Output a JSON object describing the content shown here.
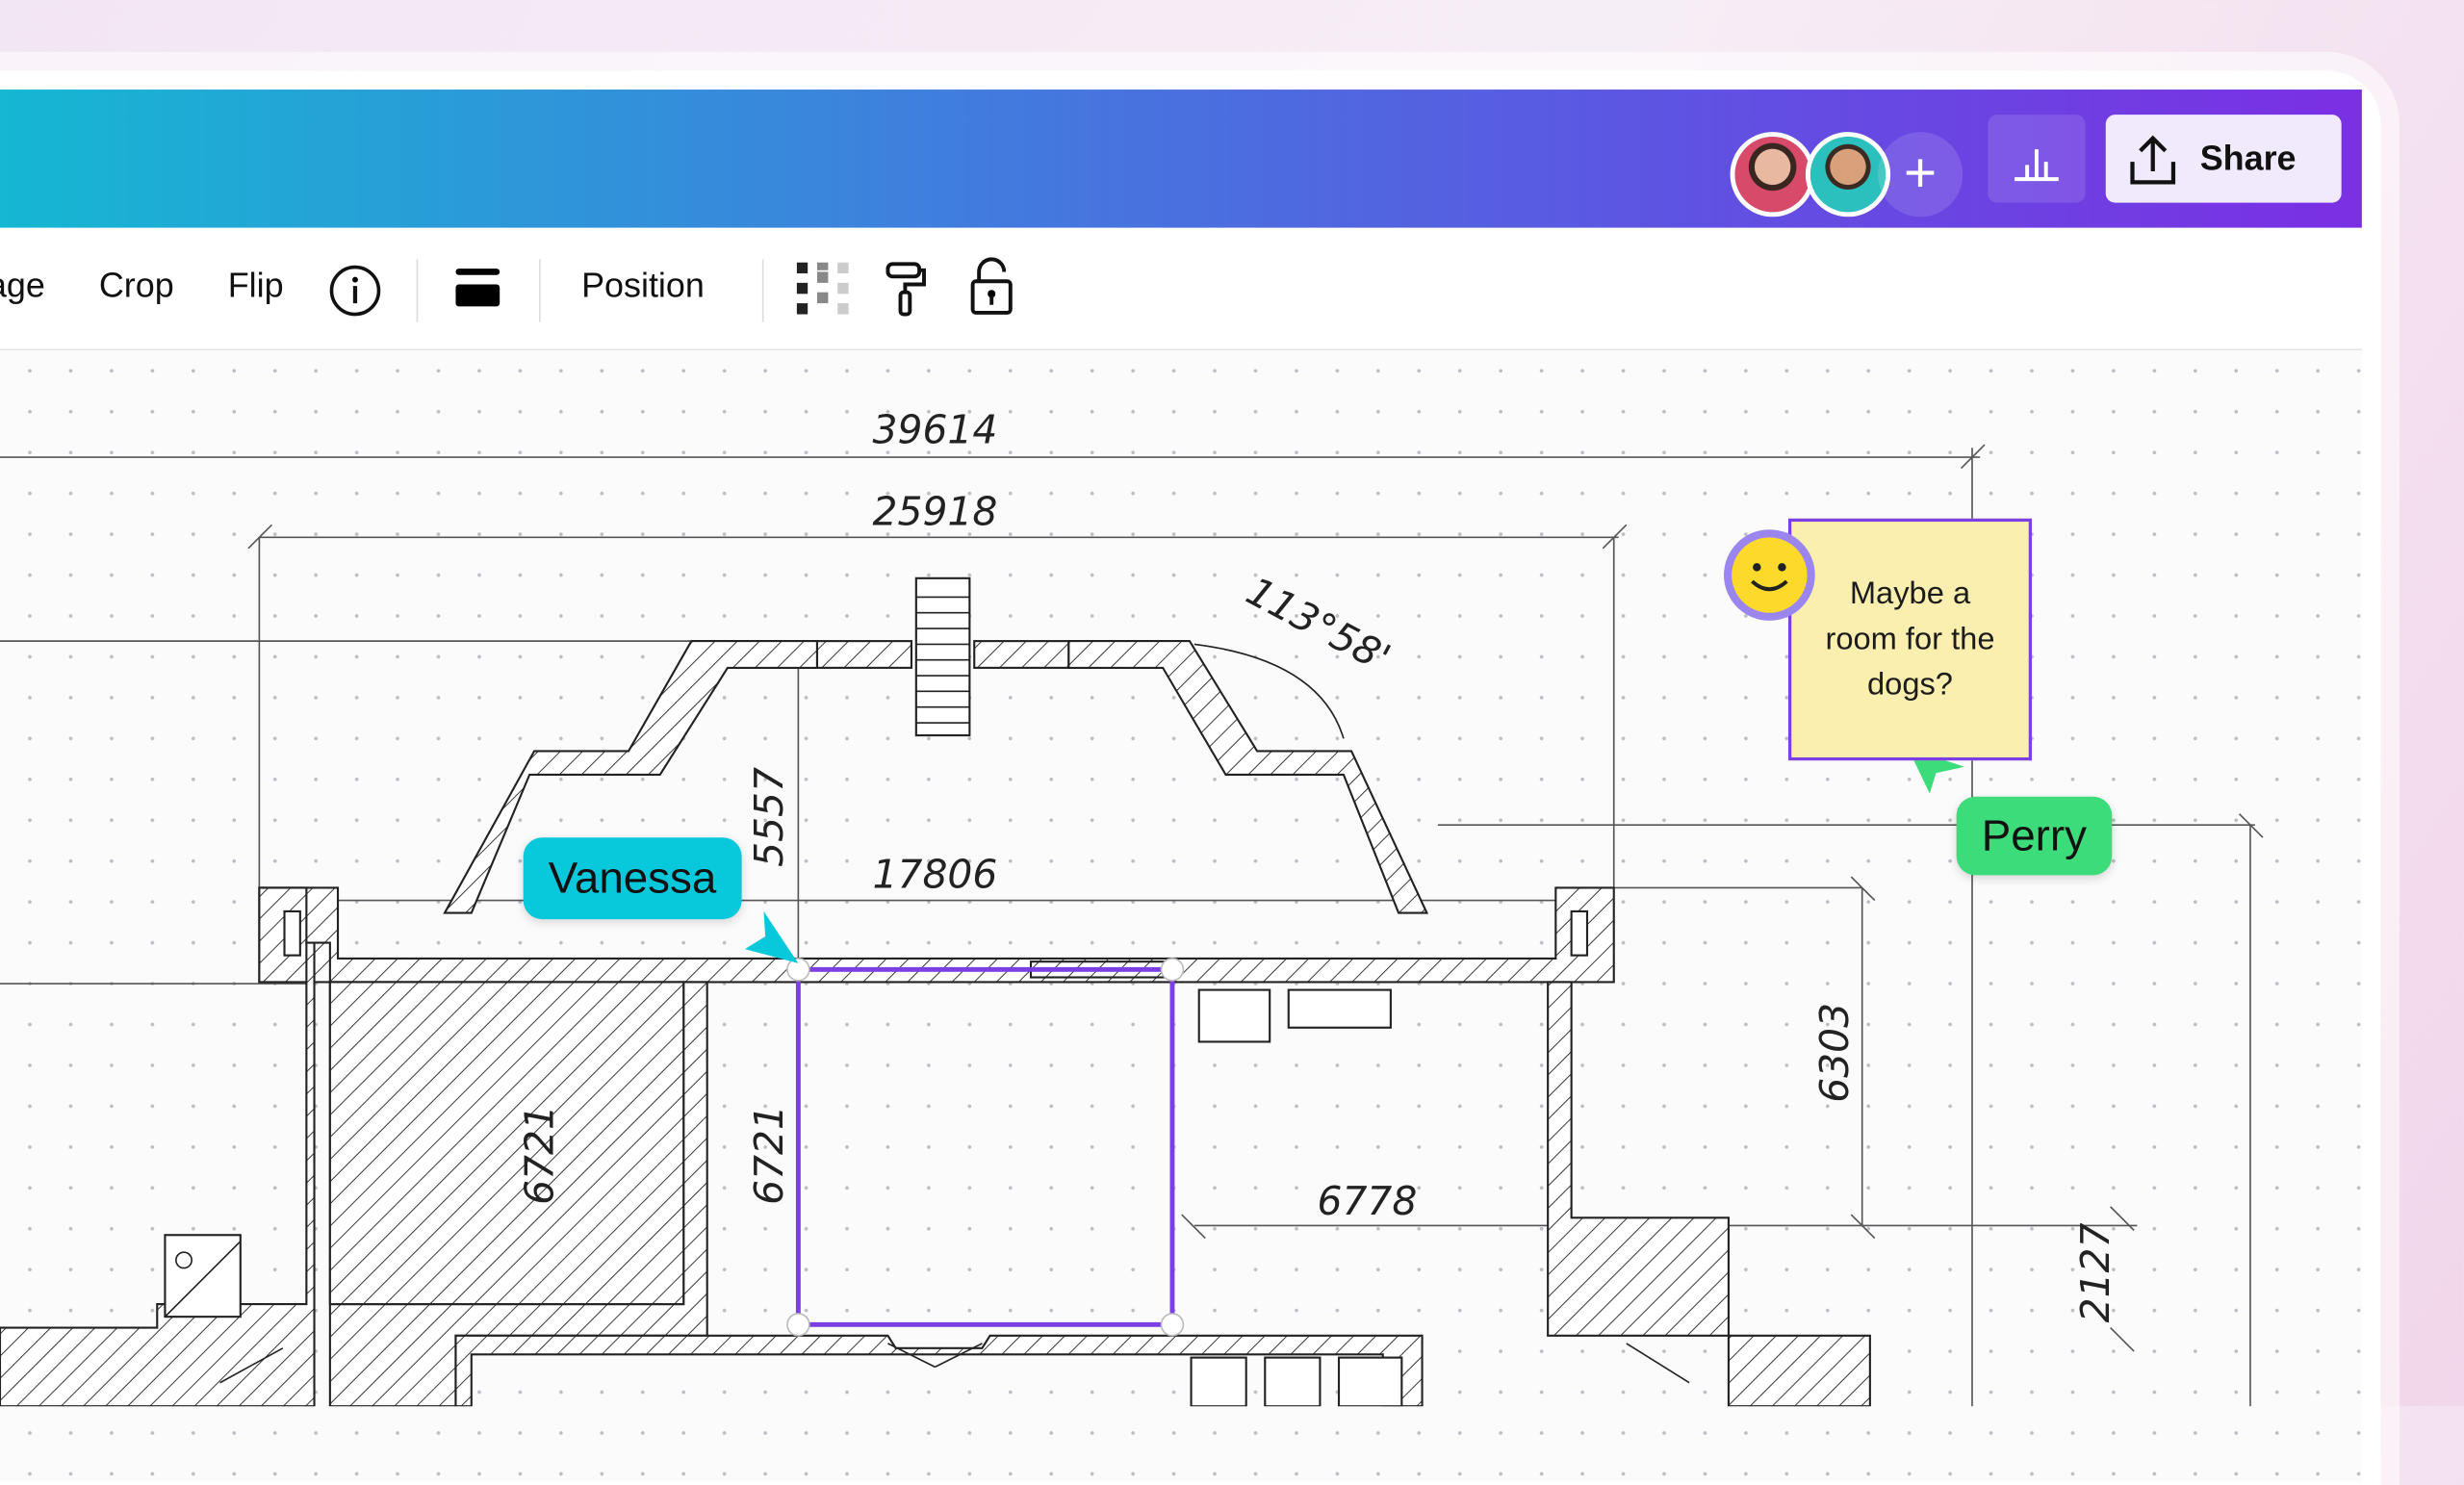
{
  "header": {
    "share_label": "Share",
    "avatars": [
      "collaborator-1",
      "collaborator-2"
    ],
    "colors": {
      "gradient_start": "#14b9d2",
      "gradient_end": "#7b2fe3"
    }
  },
  "toolbar": {
    "items": [
      "age",
      "Crop",
      "Flip"
    ],
    "position_label": "Position"
  },
  "floorplan": {
    "dims": {
      "d1": "39614",
      "d2": "25918",
      "d3": "17806",
      "d4": "5557",
      "d5": "6721",
      "d6": "6721",
      "d7": "6778",
      "d8": "6303",
      "d9": "2127",
      "angle": "113°58'"
    }
  },
  "note": {
    "text": "Maybe a room for the dogs?",
    "color": "#fbefb0"
  },
  "cursors": {
    "vanessa": {
      "name": "Vanessa",
      "color": "#08c9dc"
    },
    "perry": {
      "name": "Perry",
      "color": "#3ddc7a"
    }
  },
  "selection": {
    "color": "#7b3fe4"
  }
}
